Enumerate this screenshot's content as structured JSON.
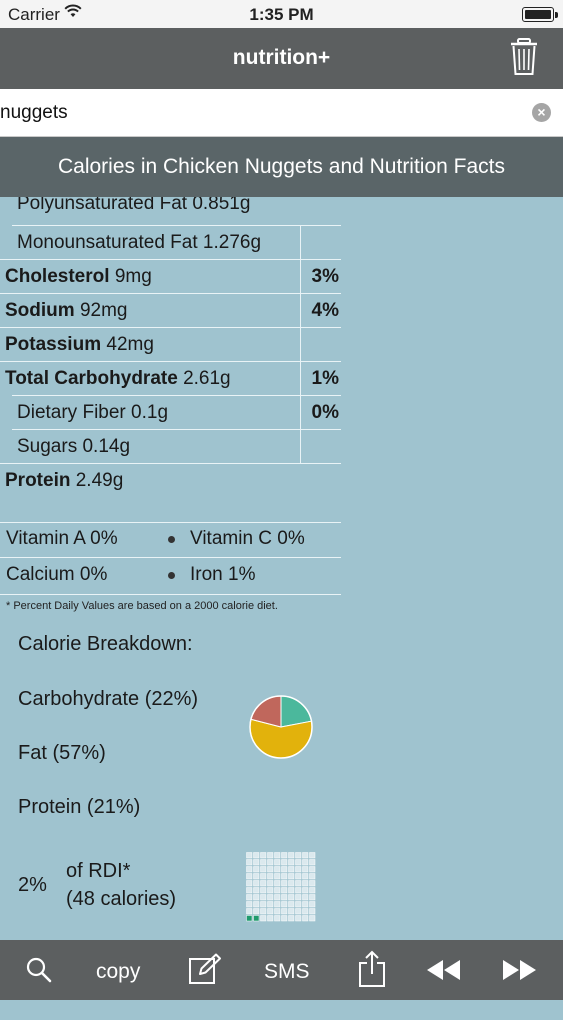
{
  "status_bar": {
    "carrier": "Carrier",
    "time": "1:35 PM"
  },
  "nav": {
    "title": "nutrition+",
    "trash_icon": "trash-icon"
  },
  "search": {
    "value": "nuggets",
    "clear_icon": "clear-icon"
  },
  "banner": {
    "title": "Calories in Chicken Nuggets and Nutrition Facts"
  },
  "nutrients": [
    {
      "name": "Polyunsaturated Fat",
      "amount": "0.851g",
      "pct": ""
    },
    {
      "name": "Monounsaturated Fat",
      "amount": "1.276g",
      "pct": ""
    },
    {
      "name": "Cholesterol",
      "amount": "9mg",
      "pct": "3%"
    },
    {
      "name": "Sodium",
      "amount": "92mg",
      "pct": "4%"
    },
    {
      "name": "Potassium",
      "amount": "42mg",
      "pct": ""
    },
    {
      "name": "Total Carbohydrate",
      "amount": "2.61g",
      "pct": "1%"
    },
    {
      "name": "Dietary Fiber",
      "amount": "0.1g",
      "pct": "0%"
    },
    {
      "name": "Sugars",
      "amount": "0.14g",
      "pct": ""
    },
    {
      "name": "Protein",
      "amount": "2.49g",
      "pct": ""
    }
  ],
  "vitamins": {
    "vitamin_a": "Vitamin A 0%",
    "vitamin_c": "Vitamin C 0%",
    "calcium": "Calcium 0%",
    "iron": "Iron 1%"
  },
  "footnote": "* Percent Daily Values are based on a 2000 calorie diet.",
  "calorie_breakdown": {
    "heading": "Calorie Breakdown:",
    "carbohydrate": "Carbohydrate (22%)",
    "fat": "Fat (57%)",
    "protein": "Protein (21%)"
  },
  "chart_data": {
    "type": "pie",
    "categories": [
      "Carbohydrate",
      "Fat",
      "Protein"
    ],
    "values": [
      22,
      57,
      21
    ],
    "colors": [
      "#4bb89c",
      "#e2b20c",
      "#c0675c"
    ]
  },
  "rdi": {
    "percent": "2%",
    "line1": "of RDI*",
    "line2": "(48 calories)",
    "filled_fraction": 0.02
  },
  "toolbar": {
    "search_icon": "search-icon",
    "copy": "copy",
    "edit_icon": "edit-icon",
    "sms": "SMS",
    "share_icon": "share-icon",
    "rewind_icon": "rewind-icon",
    "forward_icon": "fast-forward-icon"
  }
}
